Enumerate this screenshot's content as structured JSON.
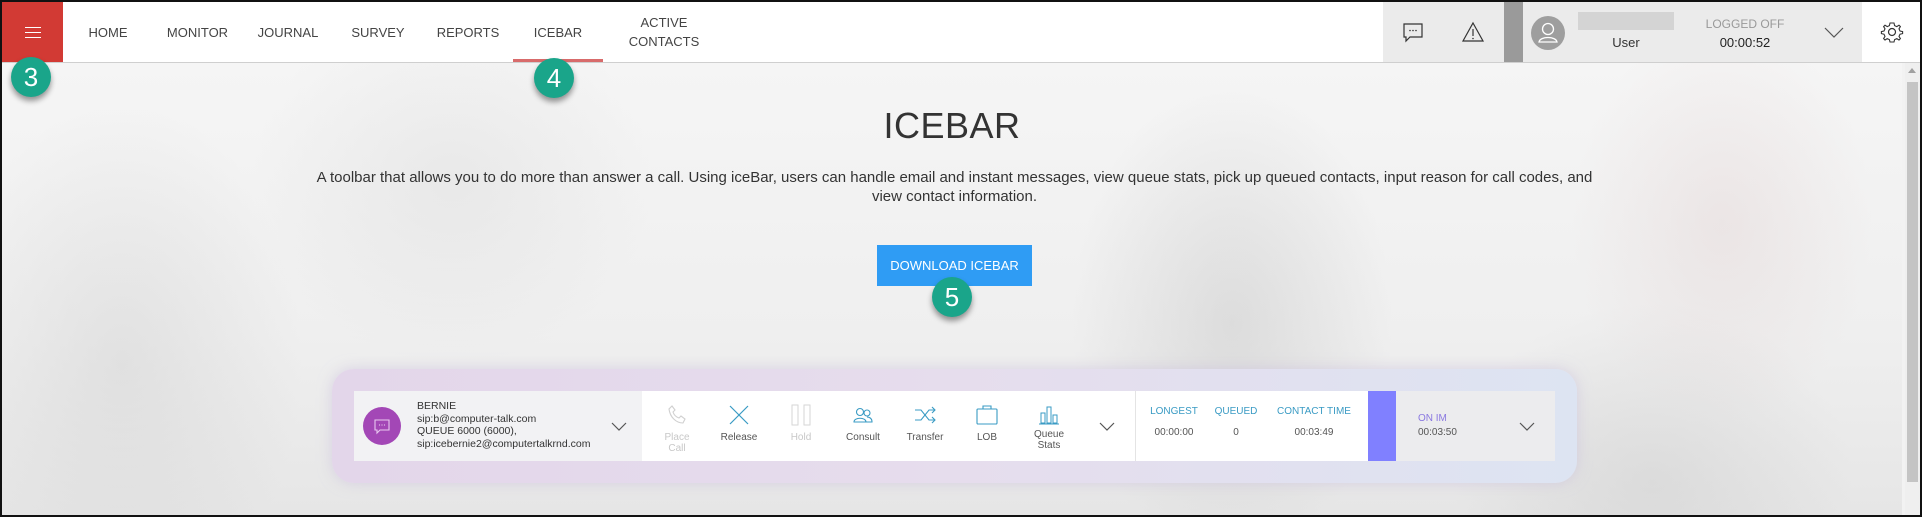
{
  "header": {
    "menu_icon": "hamburger-icon",
    "nav": [
      {
        "label": "HOME",
        "active": false
      },
      {
        "label": "MONITOR",
        "active": false
      },
      {
        "label": "JOURNAL",
        "active": false
      },
      {
        "label": "SURVEY",
        "active": false
      },
      {
        "label": "REPORTS",
        "active": false
      },
      {
        "label": "ICEBAR",
        "active": true
      },
      {
        "label": "ACTIVE\nCONTACTS",
        "active": false
      }
    ],
    "nav_active_line1": "ACTIVE",
    "nav_active_line2": "CONTACTS",
    "icons": {
      "chat": "chat-icon",
      "alert": "warning-icon",
      "settings": "gear-icon",
      "avatar": "user-avatar-icon",
      "dropdown": "chevron-down-icon"
    },
    "user": {
      "name_label": "User",
      "status": "LOGGED OFF",
      "status_time": "00:00:52"
    }
  },
  "main": {
    "title": "ICEBAR",
    "description": "A toolbar that allows you to do more than answer a call. Using iceBar, users can handle email and instant messages, view queue stats, pick up queued contacts, input reason for call codes, and view contact information.",
    "download_button": "DOWNLOAD ICEBAR"
  },
  "annotations": [
    "3",
    "4",
    "5"
  ],
  "icebar_preview": {
    "contact": {
      "name": "BERNIE",
      "sip": "sip:b@computer-talk.com",
      "queue": "QUEUE 6000 (6000),",
      "queue_sip": "sip:icebernie2@computertalkrnd.com"
    },
    "actions": [
      {
        "label": "Place\nCall",
        "line1": "Place",
        "line2": "Call",
        "icon": "phone-icon",
        "enabled": false
      },
      {
        "label": "Release",
        "icon": "close-icon",
        "enabled": true
      },
      {
        "label": "Hold",
        "icon": "pause-icon",
        "enabled": false
      },
      {
        "label": "Consult",
        "icon": "users-icon",
        "enabled": true
      },
      {
        "label": "Transfer",
        "icon": "transfer-icon",
        "enabled": true
      },
      {
        "label": "LOB",
        "icon": "briefcase-icon",
        "enabled": true
      },
      {
        "label": "Queue\nStats",
        "line1": "Queue",
        "line2": "Stats",
        "icon": "bar-chart-icon",
        "enabled": true
      }
    ],
    "stats": [
      {
        "label": "LONGEST",
        "value": "00:00:00"
      },
      {
        "label": "QUEUED",
        "value": "0"
      },
      {
        "label": "CONTACT TIME",
        "value": "00:03:49"
      }
    ],
    "status": {
      "label": "ON IM",
      "time": "00:03:50"
    },
    "colors": {
      "accent_purple": "#8080ff",
      "avatar_purple": "#a347b6",
      "stat_blue": "#3a9bc4"
    }
  },
  "colors": {
    "brand_red": "#d23a34",
    "download_blue": "#2f9cf4",
    "badge_green": "#1aa58a",
    "nav_active_underline": "#d86b6b"
  }
}
